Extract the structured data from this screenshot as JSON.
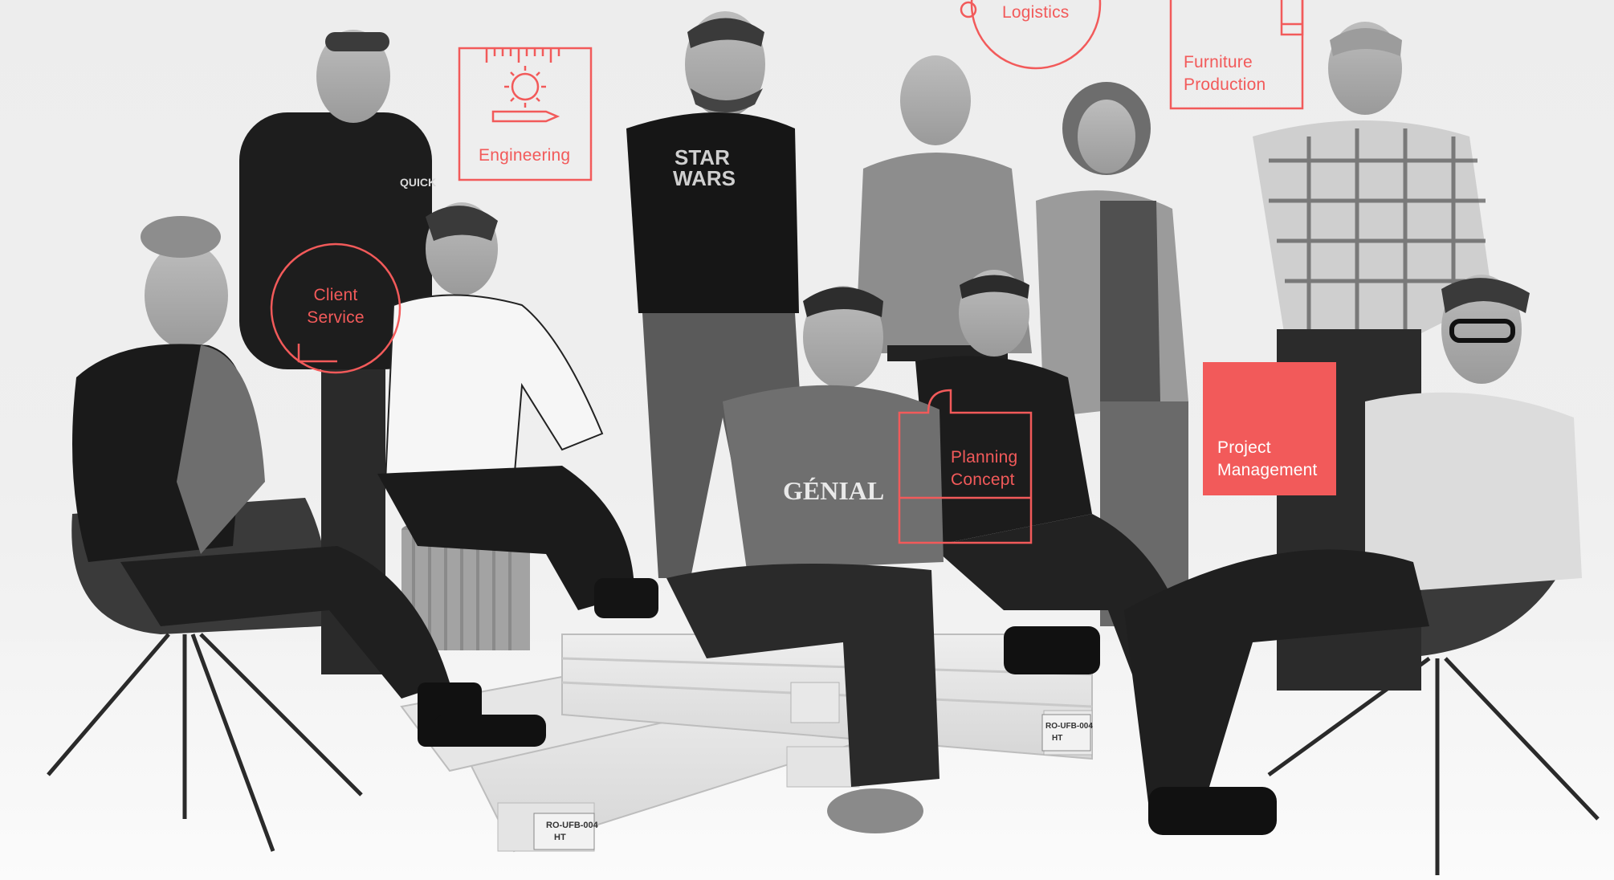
{
  "departments": {
    "logistics": "Logistics",
    "furniture_production": "Furniture\nProduction",
    "engineering": "Engineering",
    "client_service": "Client\nService",
    "planning_concept": "Planning\nConcept",
    "project_management": "Project\nManagement"
  },
  "printed_text": {
    "shirt_star_wars": "STAR\nWARS",
    "shirt_genial": "GÉNIAL",
    "hoodie_brand": "QUICK",
    "pallet_stamp_1": "RO-UFB-004\nHT",
    "pallet_stamp_2": "RO-UFB-004\nHT"
  },
  "colors": {
    "accent": "#f25a5a",
    "background": "#efefef"
  }
}
